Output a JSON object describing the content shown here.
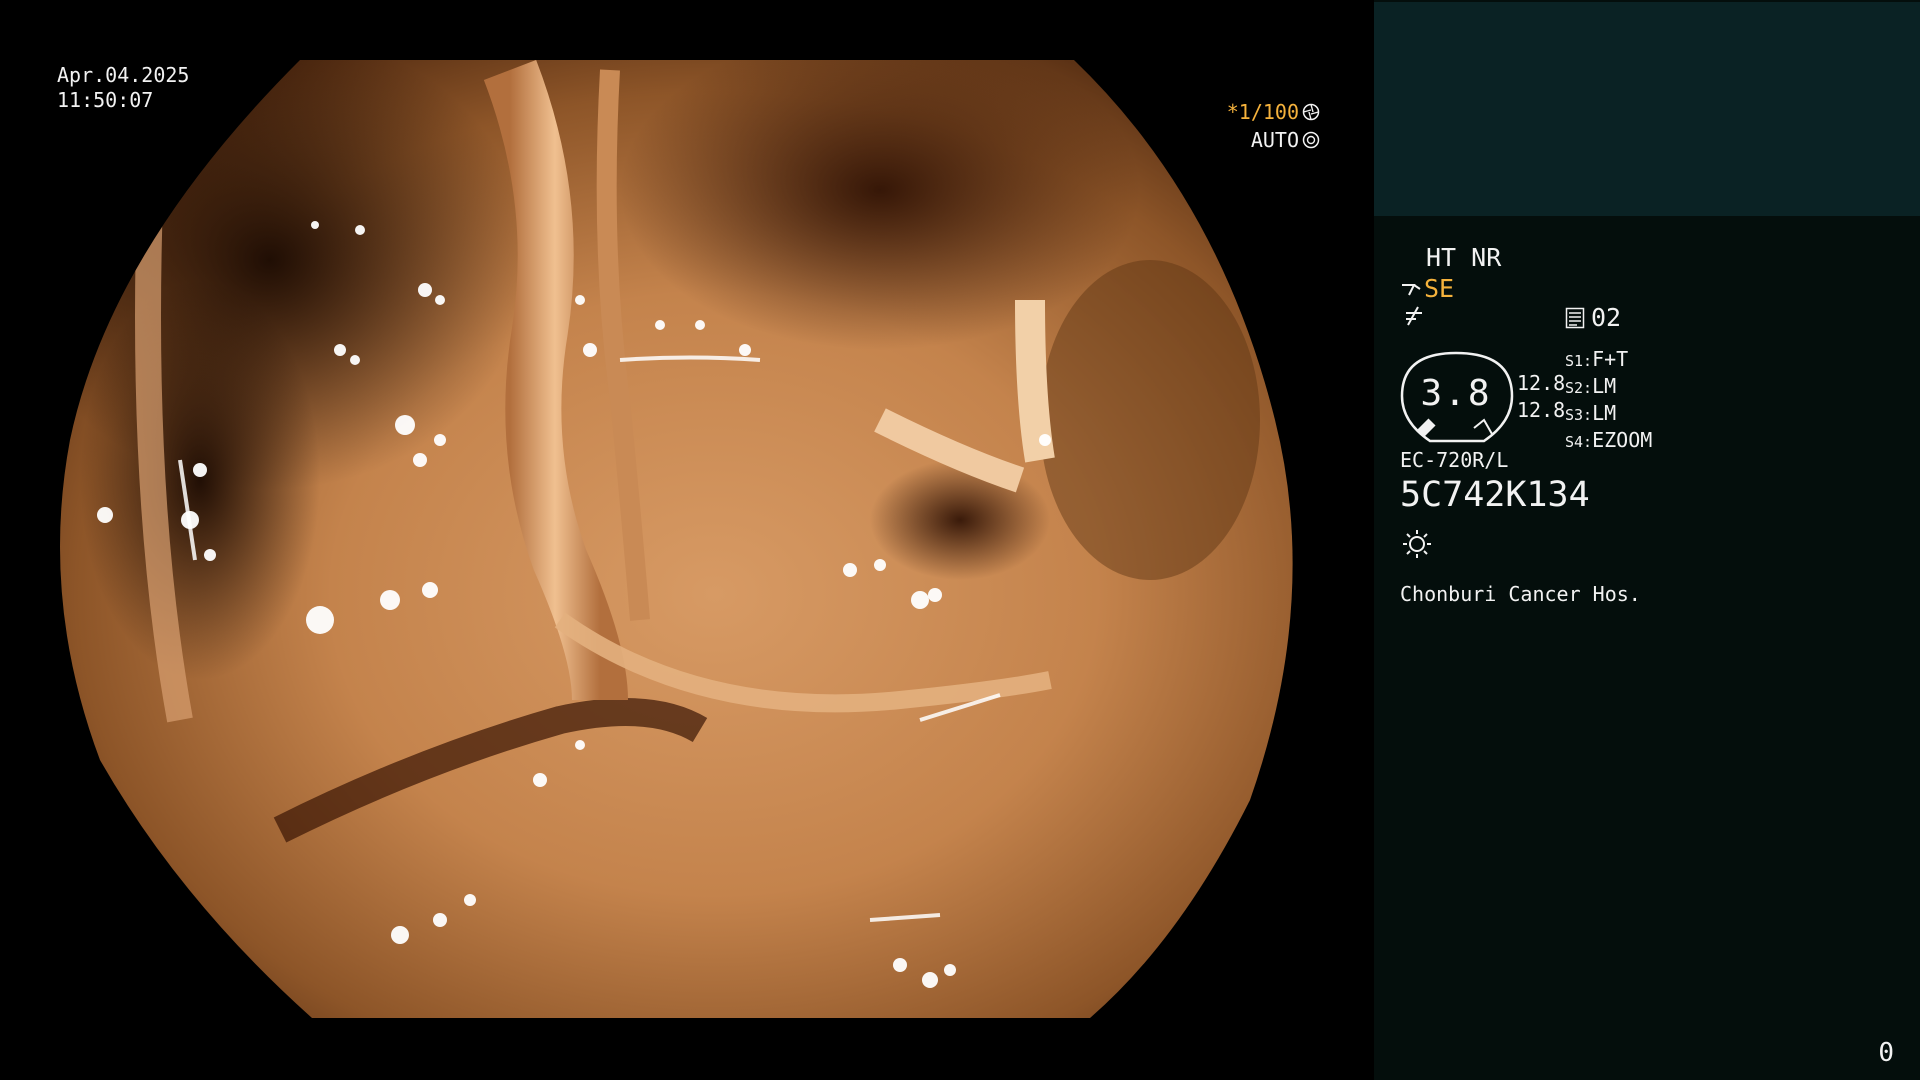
{
  "overlay": {
    "date": "Apr.04.2025",
    "time": "11:50:07",
    "shutter": "*1/100",
    "auto_label": "AUTO"
  },
  "panel": {
    "ht_nr": "HT NR",
    "se": "SE",
    "structure_level": "02",
    "gauge_value": "3.8",
    "gauge_values": [
      "12.8",
      "12.8"
    ],
    "switches": [
      {
        "key": "S1:",
        "value": "F+T"
      },
      {
        "key": "S2:",
        "value": "LM"
      },
      {
        "key": "S3:",
        "value": "LM"
      },
      {
        "key": "S4:",
        "value": "EZOOM"
      }
    ],
    "scope_model": "EC-720R/L",
    "serial": "5C742K134",
    "hospital": "Chonburi Cancer Hos.",
    "page_number": "0"
  },
  "colors": {
    "amber": "#f5b23c",
    "panel_top": "#0a2224",
    "panel_bottom": "#040e0c"
  },
  "icons": [
    "aperture-icon",
    "iris-icon",
    "scope-tip-icon",
    "not-equal-icon",
    "structure-icon",
    "light-icon"
  ]
}
